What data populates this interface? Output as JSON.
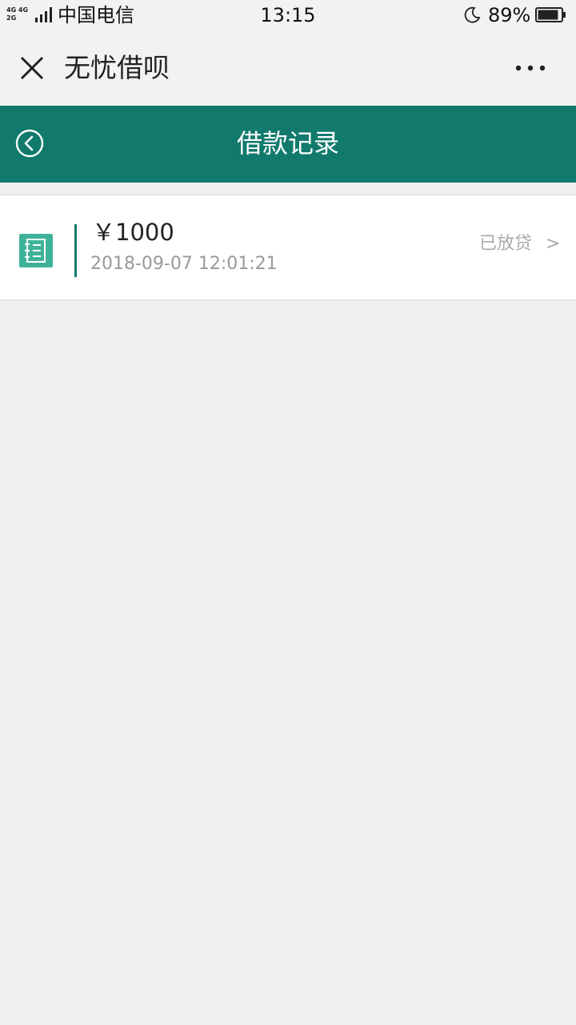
{
  "status_bar": {
    "net_type_top": "4G 4G",
    "net_type_bottom": "2G",
    "carrier": "中国电信",
    "time": "13:15",
    "battery_percent": "89%",
    "battery_level": 0.89
  },
  "title_bar": {
    "title": "无忧借呗",
    "close_icon": "close-icon",
    "more_icon": "more-icon"
  },
  "header": {
    "title": "借款记录",
    "back_icon": "back-icon",
    "background_color": "#117a6d"
  },
  "records": [
    {
      "icon": "notebook-icon",
      "amount": "￥1000",
      "date": "2018-09-07 12:01:21",
      "status": "已放贷",
      "arrow": ">"
    }
  ],
  "colors": {
    "accent": "#117a6d",
    "icon": "#3fb39a",
    "background": "#efefef"
  }
}
